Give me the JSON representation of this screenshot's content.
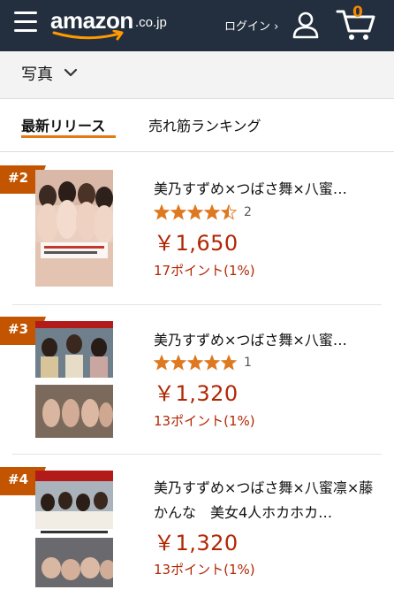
{
  "header": {
    "logo_text": "amazon",
    "logo_tld": ".co.jp",
    "login_label": "ログイン ›",
    "cart_count": "0"
  },
  "subnav": {
    "category_label": "写真"
  },
  "tabs": [
    {
      "label": "最新リリース",
      "active": true
    },
    {
      "label": "売れ筋ランキング",
      "active": false
    }
  ],
  "products": [
    {
      "rank": "#2",
      "title": "美乃すずめ×つばさ舞×八蜜…",
      "rating": 4.5,
      "rating_count": "2",
      "price": "￥1,650",
      "points": "17ポイント(1%)"
    },
    {
      "rank": "#3",
      "title": "美乃すずめ×つばさ舞×八蜜…",
      "rating": 5,
      "rating_count": "1",
      "price": "￥1,320",
      "points": "13ポイント(1%)"
    },
    {
      "rank": "#4",
      "title": "美乃すずめ×つばさ舞×八蜜凛×藤かんな　美女4人ホカホカ…",
      "price": "￥1,320",
      "points": "13ポイント(1%)"
    }
  ],
  "colors": {
    "header_bg": "#232f3e",
    "accent": "#e47911",
    "price": "#b12704",
    "badge": "#c45500",
    "star": "#de7921"
  }
}
